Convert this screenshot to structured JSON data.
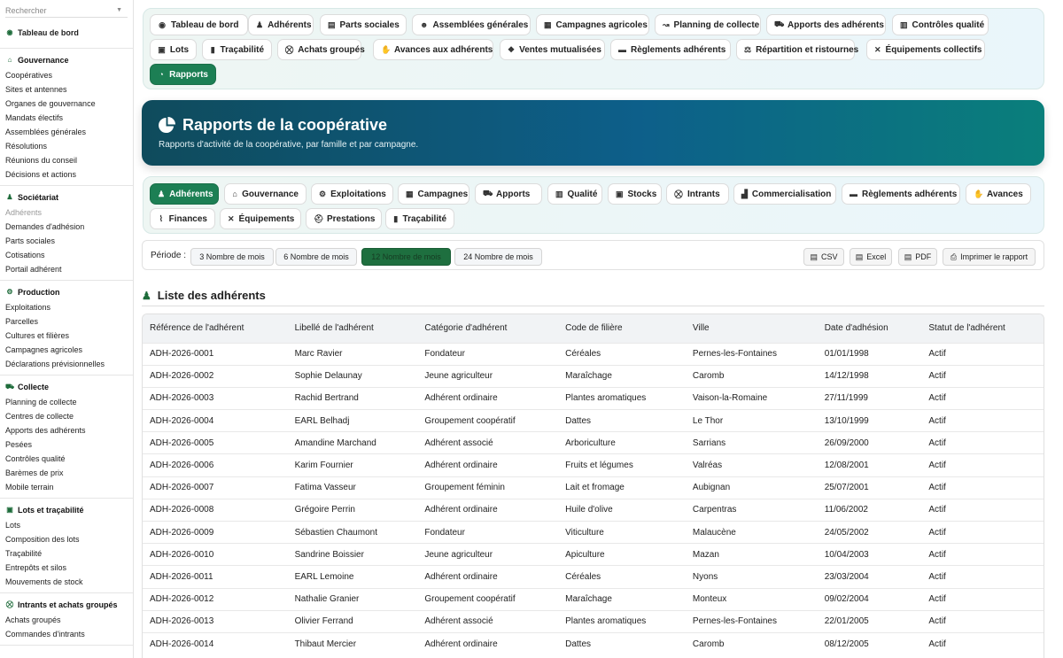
{
  "sidebar": {
    "search_placeholder": "Rechercher",
    "top_item": "Tableau de bord",
    "groups": [
      {
        "title": "Gouvernance",
        "icon": "bank-icon",
        "items": [
          "Coopératives",
          "Sites et antennes",
          "Organes de gouvernance",
          "Mandats électifs",
          "Assemblées générales",
          "Résolutions",
          "Réunions du conseil",
          "Décisions et actions"
        ]
      },
      {
        "title": "Sociétariat",
        "icon": "user-icon",
        "items": [
          "Adhérents",
          "Demandes d'adhésion",
          "Parts sociales",
          "Cotisations",
          "Portail adhérent"
        ]
      },
      {
        "title": "Production",
        "icon": "tractor-icon",
        "items": [
          "Exploitations",
          "Parcelles",
          "Cultures et filières",
          "Campagnes agricoles",
          "Déclarations prévisionnelles"
        ]
      },
      {
        "title": "Collecte",
        "icon": "truck-icon",
        "items": [
          "Planning de collecte",
          "Centres de collecte",
          "Apports des adhérents",
          "Pesées",
          "Contrôles qualité",
          "Barèmes de prix",
          "Mobile terrain"
        ]
      },
      {
        "title": "Lots et traçabilité",
        "icon": "boxes-icon",
        "items": [
          "Lots",
          "Composition des lots",
          "Traçabilité",
          "Entrepôts et silos",
          "Mouvements de stock"
        ]
      },
      {
        "title": "Intrants et achats groupés",
        "icon": "cart-icon",
        "items": [
          "Achats groupés",
          "Commandes d'intrants"
        ]
      }
    ]
  },
  "topnav": {
    "items": [
      {
        "label": "Tableau de bord",
        "icon": "dashboard-icon"
      },
      {
        "label": "Adhérents",
        "icon": "user-icon"
      },
      {
        "label": "Parts sociales",
        "icon": "coins-icon"
      },
      {
        "label": "Assemblées générales",
        "icon": "users-icon"
      },
      {
        "label": "Campagnes agricoles",
        "icon": "calendar-icon"
      },
      {
        "label": "Planning de collecte",
        "icon": "route-icon"
      },
      {
        "label": "Apports des adhérents",
        "icon": "truck-icon"
      },
      {
        "label": "Contrôles qualité",
        "icon": "scale-icon"
      },
      {
        "label": "Lots",
        "icon": "boxes-icon"
      },
      {
        "label": "Traçabilité",
        "icon": "barcode-icon"
      },
      {
        "label": "Achats groupés",
        "icon": "cart-icon"
      },
      {
        "label": "Avances aux adhérents",
        "icon": "hand-coin-icon"
      },
      {
        "label": "Ventes mutualisées",
        "icon": "handshake-icon"
      },
      {
        "label": "Règlements adhérents",
        "icon": "money-icon"
      },
      {
        "label": "Répartition et ristournes",
        "icon": "balance-icon"
      },
      {
        "label": "Équipements collectifs",
        "icon": "tools-icon"
      },
      {
        "label": "Rapports",
        "icon": "pie-chart-icon"
      }
    ]
  },
  "hero": {
    "title": "Rapports de la coopérative",
    "subtitle": "Rapports d'activité de la coopérative, par famille et par campagne."
  },
  "subnav": {
    "items": [
      {
        "label": "Adhérents",
        "icon": "user-icon"
      },
      {
        "label": "Gouvernance",
        "icon": "bank-icon"
      },
      {
        "label": "Exploitations",
        "icon": "tractor-icon"
      },
      {
        "label": "Campagnes",
        "icon": "calendar-icon"
      },
      {
        "label": "Apports",
        "icon": "truck-icon"
      },
      {
        "label": "Qualité",
        "icon": "scale-icon"
      },
      {
        "label": "Stocks",
        "icon": "boxes-icon"
      },
      {
        "label": "Intrants",
        "icon": "cart-icon"
      },
      {
        "label": "Commercialisation",
        "icon": "shop-icon"
      },
      {
        "label": "Règlements adhérents",
        "icon": "money-icon"
      },
      {
        "label": "Avances",
        "icon": "hand-coin-icon"
      },
      {
        "label": "Finances",
        "icon": "line-chart-icon"
      },
      {
        "label": "Équipements",
        "icon": "tools-icon"
      },
      {
        "label": "Prestations",
        "icon": "hardhat-icon"
      },
      {
        "label": "Traçabilité",
        "icon": "barcode-icon"
      }
    ]
  },
  "period": {
    "label": "Période :",
    "options": [
      "3 Nombre de mois",
      "6 Nombre de mois",
      "12 Nombre de mois",
      "24 Nombre de mois"
    ],
    "selected": "12 Nombre de mois",
    "exports": [
      "CSV",
      "Excel",
      "PDF",
      "Imprimer le rapport"
    ]
  },
  "list": {
    "title": "Liste des adhérents",
    "columns": [
      "Référence de l'adhérent",
      "Libellé de l'adhérent",
      "Catégorie d'adhérent",
      "Code de filière",
      "Ville",
      "Date d'adhésion",
      "Statut de l'adhérent"
    ],
    "rows": [
      [
        "ADH-2026-0001",
        "Marc Ravier",
        "Fondateur",
        "Céréales",
        "Pernes-les-Fontaines",
        "01/01/1998",
        "Actif"
      ],
      [
        "ADH-2026-0002",
        "Sophie Delaunay",
        "Jeune agriculteur",
        "Maraîchage",
        "Caromb",
        "14/12/1998",
        "Actif"
      ],
      [
        "ADH-2026-0003",
        "Rachid Bertrand",
        "Adhérent ordinaire",
        "Plantes aromatiques",
        "Vaison-la-Romaine",
        "27/11/1999",
        "Actif"
      ],
      [
        "ADH-2026-0004",
        "EARL Belhadj",
        "Groupement coopératif",
        "Dattes",
        "Le Thor",
        "13/10/1999",
        "Actif"
      ],
      [
        "ADH-2026-0005",
        "Amandine Marchand",
        "Adhérent associé",
        "Arboriculture",
        "Sarrians",
        "26/09/2000",
        "Actif"
      ],
      [
        "ADH-2026-0006",
        "Karim Fournier",
        "Adhérent ordinaire",
        "Fruits et légumes",
        "Valréas",
        "12/08/2001",
        "Actif"
      ],
      [
        "ADH-2026-0007",
        "Fatima Vasseur",
        "Groupement féminin",
        "Lait et fromage",
        "Aubignan",
        "25/07/2001",
        "Actif"
      ],
      [
        "ADH-2026-0008",
        "Grégoire Perrin",
        "Adhérent ordinaire",
        "Huile d'olive",
        "Carpentras",
        "11/06/2002",
        "Actif"
      ],
      [
        "ADH-2026-0009",
        "Sébastien Chaumont",
        "Fondateur",
        "Viticulture",
        "Malaucène",
        "24/05/2002",
        "Actif"
      ],
      [
        "ADH-2026-0010",
        "Sandrine Boissier",
        "Jeune agriculteur",
        "Apiculture",
        "Mazan",
        "10/04/2003",
        "Actif"
      ],
      [
        "ADH-2026-0011",
        "EARL Lemoine",
        "Adhérent ordinaire",
        "Céréales",
        "Nyons",
        "23/03/2004",
        "Actif"
      ],
      [
        "ADH-2026-0012",
        "Nathalie Granier",
        "Groupement coopératif",
        "Maraîchage",
        "Monteux",
        "09/02/2004",
        "Actif"
      ],
      [
        "ADH-2026-0013",
        "Olivier Ferrand",
        "Adhérent associé",
        "Plantes aromatiques",
        "Pernes-les-Fontaines",
        "22/01/2005",
        "Actif"
      ],
      [
        "ADH-2026-0014",
        "Thibaut Mercier",
        "Adhérent ordinaire",
        "Dattes",
        "Caromb",
        "08/12/2005",
        "Actif"
      ]
    ]
  }
}
